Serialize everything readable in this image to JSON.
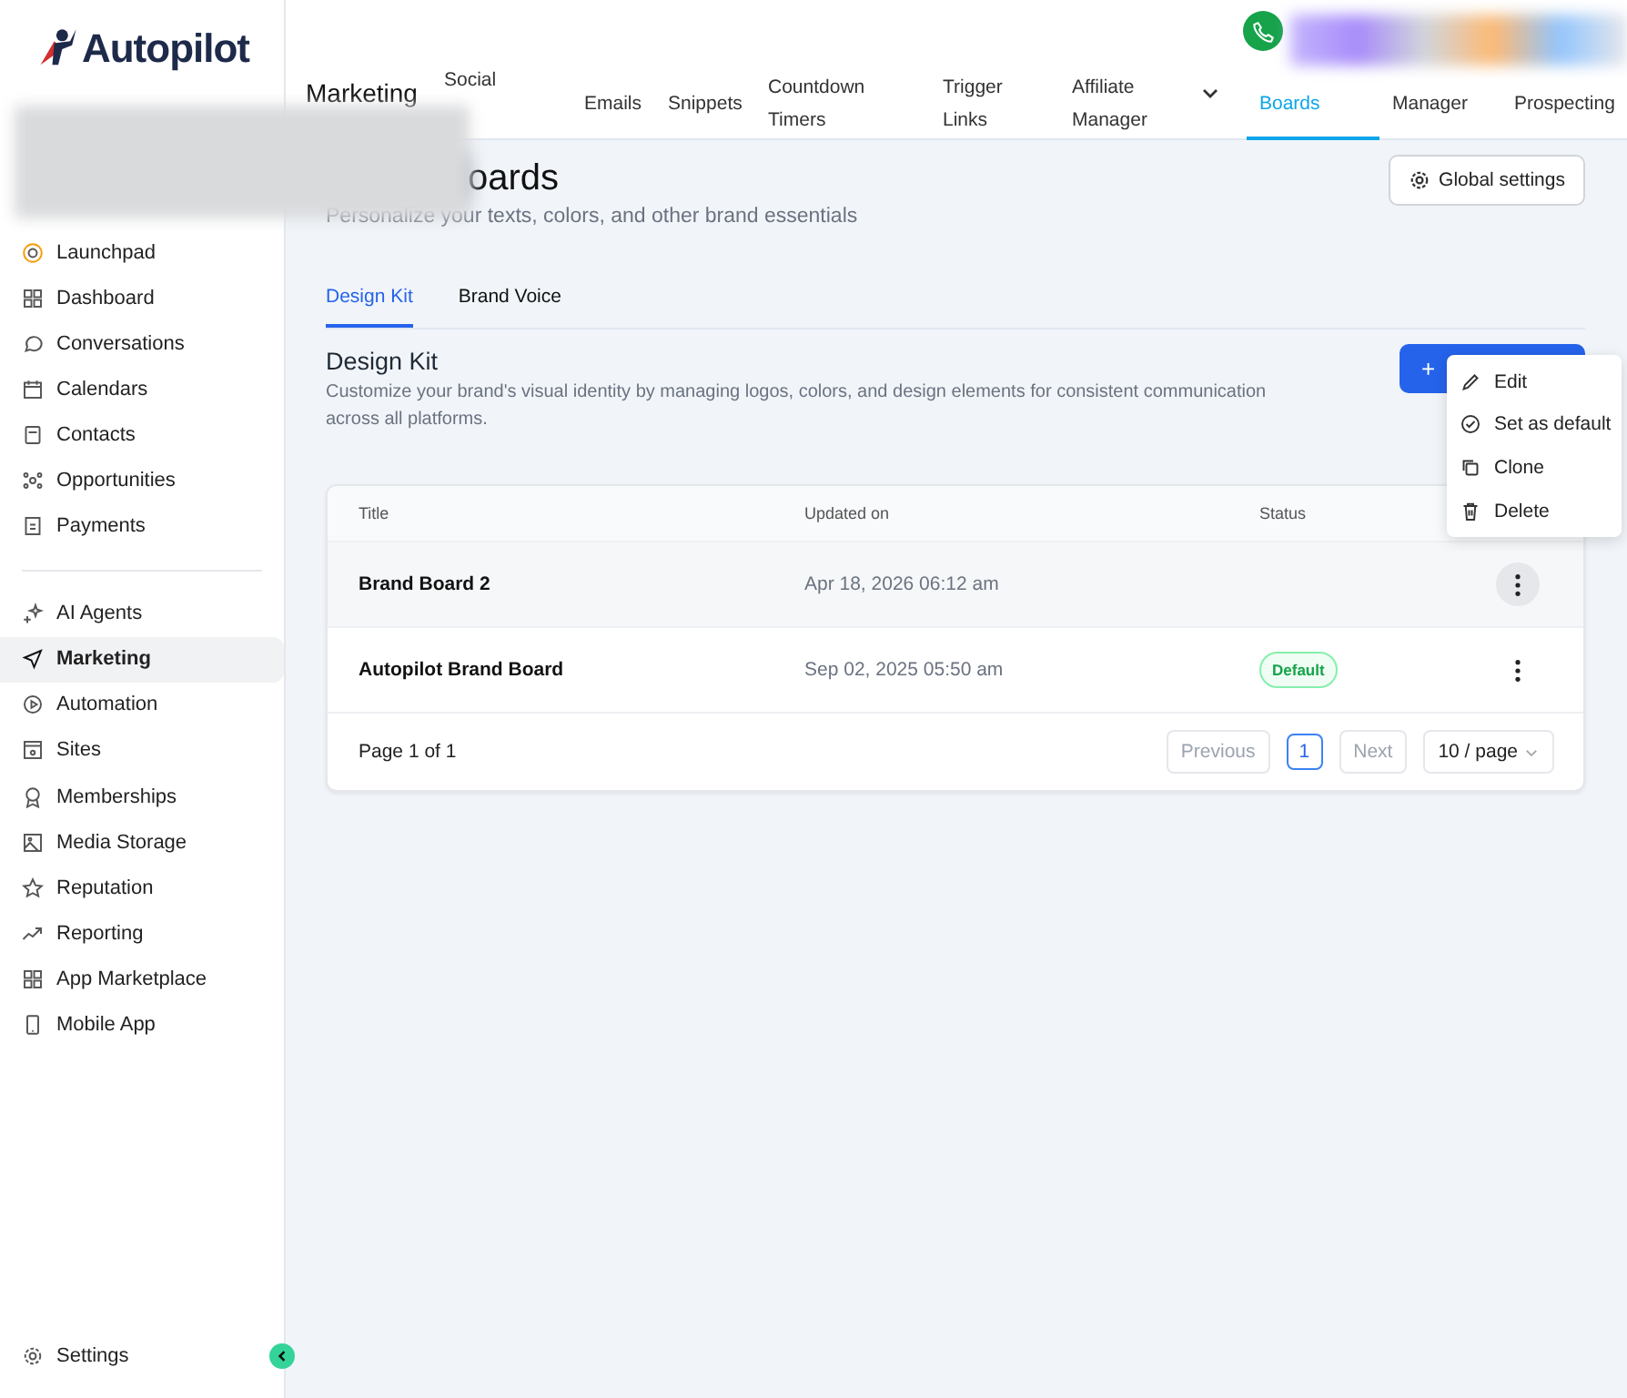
{
  "logo": {
    "text": "Autopilot"
  },
  "sidebar": {
    "items": [
      {
        "label": "Launchpad",
        "selected": false
      },
      {
        "label": "Dashboard",
        "selected": false
      },
      {
        "label": "Conversations",
        "selected": false
      },
      {
        "label": "Calendars",
        "selected": false
      },
      {
        "label": "Contacts",
        "selected": false
      },
      {
        "label": "Opportunities",
        "selected": false
      },
      {
        "label": "Payments",
        "selected": false
      }
    ],
    "items_2": [
      {
        "label": "AI Agents",
        "selected": false
      },
      {
        "label": "Marketing",
        "selected": true
      },
      {
        "label": "Automation",
        "selected": false
      },
      {
        "label": "Sites",
        "selected": false
      },
      {
        "label": "Memberships",
        "selected": false
      },
      {
        "label": "Media Storage",
        "selected": false
      },
      {
        "label": "Reputation",
        "selected": false
      },
      {
        "label": "Reporting",
        "selected": false
      },
      {
        "label": "App Marketplace",
        "selected": false
      },
      {
        "label": "Mobile App",
        "selected": false
      }
    ],
    "settings": "Settings"
  },
  "topnav": {
    "title": "Marketing",
    "tabs": [
      {
        "label": "Social",
        "selected": false
      },
      {
        "label": "Emails",
        "selected": false
      },
      {
        "label": "Snippets",
        "selected": false
      },
      {
        "label": "Countdown Timers",
        "selected": false
      },
      {
        "label": "Trigger Links",
        "selected": false
      },
      {
        "label": "Affiliate Manager",
        "selected": false
      },
      {
        "label": "Boards",
        "selected": true
      },
      {
        "label": "Manager",
        "selected": false
      },
      {
        "label": "Prospecting",
        "selected": false
      }
    ]
  },
  "page": {
    "title": "oards",
    "subtitle": "Personalize your texts, colors, and other brand essentials",
    "global_settings": "Global settings"
  },
  "subtabs": [
    {
      "label": "Design Kit",
      "selected": true
    },
    {
      "label": "Brand Voice",
      "selected": false
    }
  ],
  "section": {
    "title": "Design Kit",
    "description": "Customize your brand's visual identity by managing logos, colors, and design elements for consistent communication across all platforms.",
    "add_button": "+"
  },
  "table": {
    "columns": [
      "Title",
      "Updated on",
      "Status"
    ],
    "rows": [
      {
        "title": "Brand Board 2",
        "updated": "Apr 18, 2026 06:12 am",
        "selected": true
      },
      {
        "title": "Autopilot Brand Board",
        "updated": "Sep 02, 2025 05:50 am",
        "status": "Default",
        "selected": false
      }
    ],
    "page_info": "Page 1 of 1",
    "previous": "Previous",
    "page": "1",
    "next": "Next",
    "page_size": "10 / page"
  },
  "menu": [
    {
      "label": "Edit"
    },
    {
      "label": "Set as default"
    },
    {
      "label": "Clone"
    },
    {
      "label": "Delete"
    }
  ]
}
